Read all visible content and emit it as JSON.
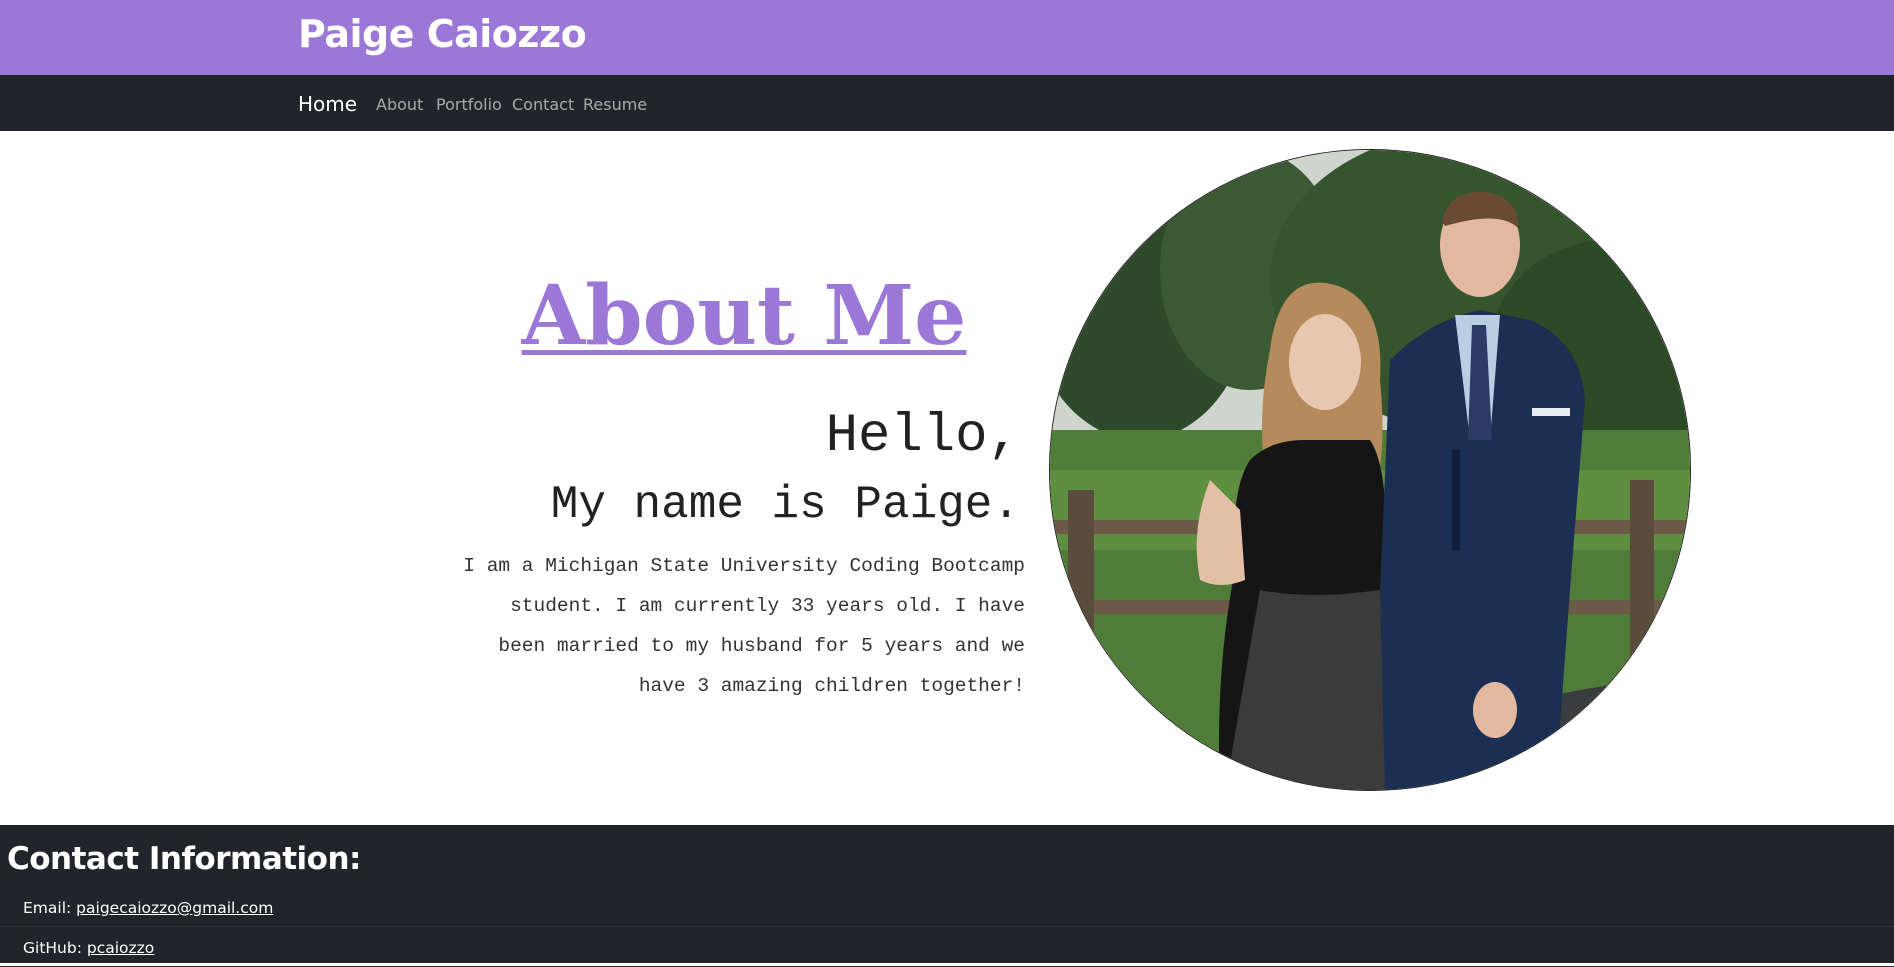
{
  "header": {
    "brand_title": "Paige Caiozzo"
  },
  "nav": {
    "home": "Home",
    "items": [
      "About",
      "Portfolio",
      "Contact",
      "Resume"
    ]
  },
  "about": {
    "heading": "About Me",
    "hello": "Hello,",
    "name_line": "My name is Paige.",
    "bio": "I am a Michigan State University Coding Bootcamp student. I am currently 33 years old. I have been married to my husband for 5 years and we have 3 amazing children together!",
    "photo": "couple-photo"
  },
  "footer": {
    "title": "Contact Information:",
    "email_label": "Email:",
    "email_value": "paigecaiozzo@gmail.com",
    "github_label": "GitHub:",
    "github_value": "pcaiozzo"
  },
  "colors": {
    "brand_purple": "#9b77d7",
    "nav_dark": "#212529"
  }
}
